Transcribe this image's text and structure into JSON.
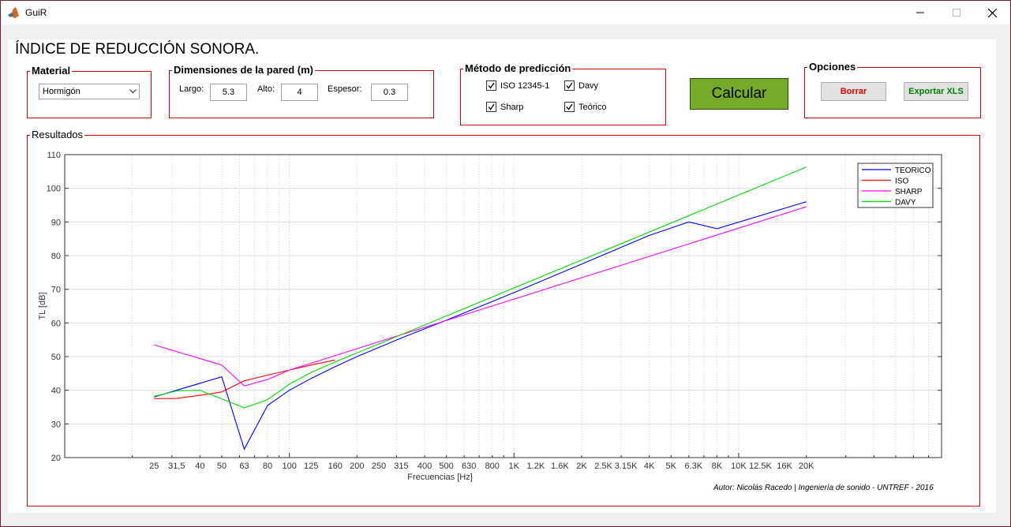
{
  "window": {
    "title": "GuiR"
  },
  "heading": "ÍNDICE DE REDUCCIÓN SONORA.",
  "material": {
    "title": "Material",
    "selected": "Hormigón"
  },
  "dimensions": {
    "title": "Dimensiones de la pared (m)",
    "largo_label": "Largo:",
    "largo_value": "5.3",
    "alto_label": "Alto:",
    "alto_value": "4",
    "espesor_label": "Espesor:",
    "espesor_value": "0.3"
  },
  "method": {
    "title": "Método de predicción",
    "options": [
      {
        "label": "ISO 12345-1",
        "checked": true
      },
      {
        "label": "Davy",
        "checked": true
      },
      {
        "label": "Sharp",
        "checked": true
      },
      {
        "label": "Teórico",
        "checked": true
      }
    ]
  },
  "calc_label": "Calcular",
  "options": {
    "title": "Opciones",
    "borrar_label": "Borrar",
    "exportar_label": "Exportar XLS"
  },
  "results_title": "Resultados",
  "author": "Autor: Nicolás Racedo | Ingeniería de sonido - UNTREF - 2016",
  "colors": {
    "border_red": "#d00000",
    "calc_green": "#76ab29",
    "borrar_text": "#e00000",
    "exportar_text": "#008000"
  },
  "chart_data": {
    "type": "line",
    "xlabel": "Frecuencias [Hz]",
    "ylabel": "TL [dB]",
    "xscale": "log",
    "xlim": [
      10,
      80000
    ],
    "ylim": [
      20,
      110
    ],
    "yticks": [
      20,
      30,
      40,
      50,
      60,
      70,
      80,
      90,
      100,
      110
    ],
    "grid": true,
    "legend_position": "top-right",
    "x_tick_values": [
      25,
      31.5,
      40,
      50,
      63,
      80,
      100,
      125,
      160,
      200,
      250,
      315,
      400,
      500,
      630,
      800,
      1000,
      1250,
      1600,
      2000,
      2500,
      3150,
      4000,
      5000,
      6300,
      8000,
      10000,
      12500,
      16000,
      20000
    ],
    "x_tick_labels": [
      "25",
      "31,5",
      "40",
      "50",
      "63",
      "80",
      "100",
      "125",
      "160",
      "200",
      "250",
      "315",
      "400",
      "500",
      "630",
      "800",
      "1K",
      "1.2K",
      "1.6K",
      "2K",
      "2.5K",
      "3.15K",
      "4K",
      "5K",
      "6.3K",
      "8K",
      "10K",
      "12.5K",
      "16K",
      "20K"
    ],
    "series": [
      {
        "name": "TEORICO",
        "color": "#0000ff",
        "x": [
          25,
          50,
          63,
          80,
          100,
          125,
          160,
          200,
          315,
          500,
          1000,
          2000,
          4000,
          6000,
          8000,
          20000
        ],
        "y": [
          38,
          44,
          22.5,
          35.5,
          40,
          43.5,
          47,
          50,
          55.5,
          60.8,
          69,
          77.5,
          86,
          90,
          88,
          96
        ]
      },
      {
        "name": "ISO",
        "color": "#ff0000",
        "x": [
          25,
          31.5,
          40,
          50,
          63,
          80,
          100,
          125,
          160
        ],
        "y": [
          37.5,
          37.6,
          38.5,
          39.5,
          42.8,
          44.5,
          46,
          47.5,
          49
        ]
      },
      {
        "name": "SHARP",
        "color": "#ff00ff",
        "x": [
          25,
          50,
          63,
          80,
          100,
          20000
        ],
        "y": [
          53.5,
          47.5,
          41.3,
          43.2,
          46,
          94.5
        ]
      },
      {
        "name": "DAVY",
        "color": "#00dd00",
        "x": [
          25,
          31.5,
          40,
          63,
          80,
          100,
          125,
          160,
          20000
        ],
        "y": [
          38.2,
          39.8,
          40,
          34.8,
          37.2,
          41.8,
          45.3,
          48.4,
          106.3
        ]
      }
    ]
  }
}
